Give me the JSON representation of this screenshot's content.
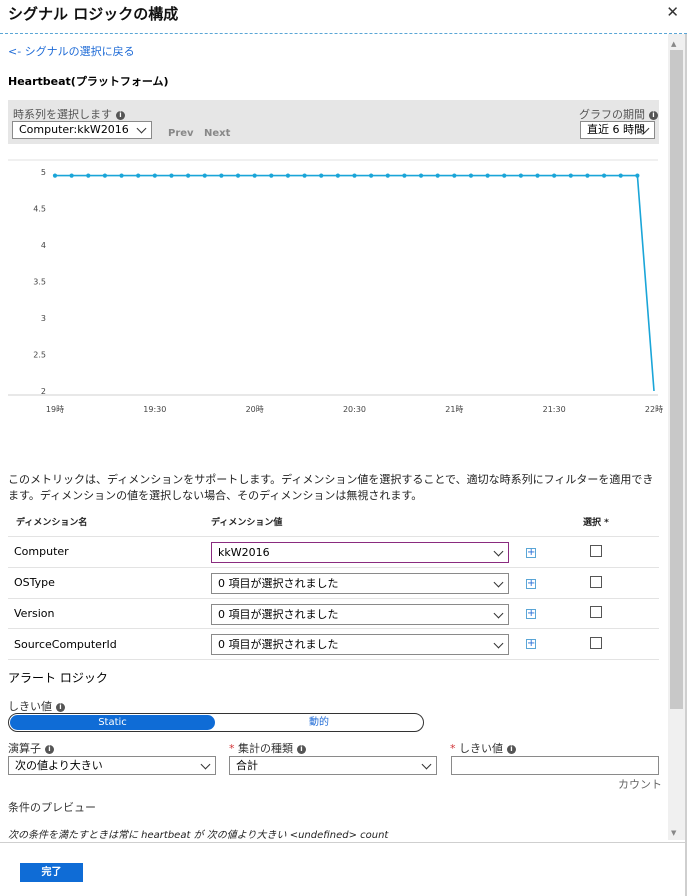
{
  "header": {
    "title": "シグナル ロジックの構成",
    "close_icon": "close-icon"
  },
  "back_link": "<- シグナルの選択に戻る",
  "signal_title": "Heartbeat(プラットフォーム)",
  "timeseries": {
    "label": "時系列を選択します",
    "selected": "Computer:kkW2016",
    "prev": "Prev",
    "next": "Next",
    "period_label": "グラフの期間",
    "period_value": "直近 6 時間"
  },
  "chart_data": {
    "type": "line",
    "x": [
      "19時",
      "19:30",
      "20時",
      "20:30",
      "21時",
      "21:30",
      "22時"
    ],
    "y_ticks": [
      "2",
      "2.5",
      "3",
      "3.5",
      "4",
      "4.5",
      "5"
    ],
    "ylim": [
      2,
      5
    ],
    "xlim_hours": [
      19,
      22
    ],
    "color": "#1aa5d8",
    "series": [
      {
        "x_hours": [
          19.0,
          19.0833,
          19.1667,
          19.25,
          19.3333,
          19.4167,
          19.5,
          19.5833,
          19.6667,
          19.75,
          19.8333,
          19.9167,
          20.0,
          20.0833,
          20.1667,
          20.25,
          20.3333,
          20.4167,
          20.5,
          20.5833,
          20.6667,
          20.75,
          20.8333,
          20.9167,
          21.0,
          21.0833,
          21.1667,
          21.25,
          21.3333,
          21.4167,
          21.5,
          21.5833,
          21.6667,
          21.75,
          21.8333,
          21.9167,
          22.0
        ],
        "values": [
          4.95,
          4.95,
          4.95,
          4.95,
          4.95,
          4.95,
          4.95,
          4.95,
          4.95,
          4.95,
          4.95,
          4.95,
          4.95,
          4.95,
          4.95,
          4.95,
          4.95,
          4.95,
          4.95,
          4.95,
          4.95,
          4.95,
          4.95,
          4.95,
          4.95,
          4.95,
          4.95,
          4.95,
          4.95,
          4.95,
          4.95,
          4.95,
          4.95,
          4.95,
          4.95,
          4.95,
          2.0
        ]
      }
    ],
    "grid": false
  },
  "dimension_note": "このメトリックは、ディメンションをサポートします。ディメンション値を選択することで、適切な時系列にフィルターを適用できます。ディメンションの値を選択しない場合、そのディメンションは無視されます。",
  "dimension_table": {
    "headers": [
      "ディメンション名",
      "ディメンション値",
      "選択 *"
    ],
    "rows": [
      {
        "name": "Computer",
        "value": "kkW2016"
      },
      {
        "name": "OSType",
        "value": "0 項目が選択されました"
      },
      {
        "name": "Version",
        "value": "0 項目が選択されました"
      },
      {
        "name": "SourceComputerId",
        "value": "0 項目が選択されました"
      }
    ]
  },
  "alert_logic": {
    "title": "アラート ロジック",
    "threshold_label": "しきい値",
    "toggle_static": "Static",
    "toggle_dynamic": "動的",
    "operator_label": "演算子",
    "operator_value": "次の値より大きい",
    "aggregation_label": "集計の種類",
    "aggregation_value": "合計",
    "threshold_value_label": "しきい値",
    "threshold_value": "",
    "unit": "カウント",
    "preview_label": "条件のプレビュー",
    "preview_text": "次の条件を満たすときは常に heartbeat が 次の値より大きい <undefined> count"
  },
  "footer": {
    "done": "完了"
  }
}
